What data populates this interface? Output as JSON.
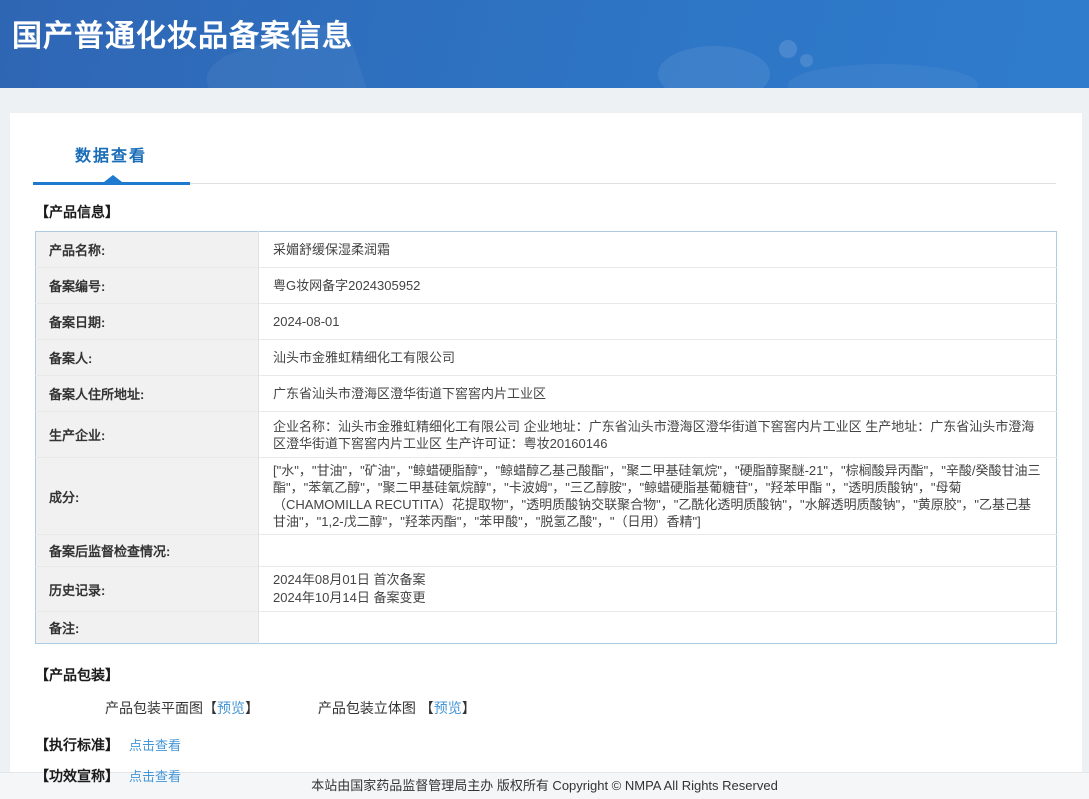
{
  "theme": {
    "header_blue_start": "#2f66b4",
    "header_blue_end": "#2f7ccd",
    "accent_blue": "#1e7ace",
    "tab_text_blue": "#1a6db8",
    "link_blue": "#4596d6",
    "label_cell_bg": "#f1f1f1",
    "table_border_blue": "#aecbe4"
  },
  "header": {
    "title": "国产普通化妆品备案信息"
  },
  "tabs": {
    "data_view": "数据查看"
  },
  "product_info": {
    "section_title": "【产品信息】",
    "rows": [
      {
        "label": "产品名称:",
        "value": "采媚舒缓保湿柔润霜"
      },
      {
        "label": "备案编号:",
        "value": "粤G妆网备字2024305952"
      },
      {
        "label": "备案日期:",
        "value": "2024-08-01"
      },
      {
        "label": "备案人:",
        "value": "汕头市金雅虹精细化工有限公司"
      },
      {
        "label": "备案人住所地址:",
        "value": "广东省汕头市澄海区澄华街道下窖窖内片工业区"
      },
      {
        "label": "生产企业:",
        "value": "企业名称：汕头市金雅虹精细化工有限公司 企业地址：广东省汕头市澄海区澄华街道下窖窖内片工业区 生产地址：广东省汕头市澄海区澄华街道下窖窖内片工业区 生产许可证：粤妆20160146"
      },
      {
        "label": "成分:",
        "value": "[\"水\"，\"甘油\"，\"矿油\"，\"鲸蜡硬脂醇\"，\"鲸蜡醇乙基己酸酯\"，\"聚二甲基硅氧烷\"，\"硬脂醇聚醚-21\"，\"棕榈酸异丙酯\"，\"辛酸/癸酸甘油三酯\"，\"苯氧乙醇\"，\"聚二甲基硅氧烷醇\"，\"卡波姆\"，\"三乙醇胺\"，\"鲸蜡硬脂基葡糖苷\"，\"羟苯甲酯 \"，\"透明质酸钠\"，\"母菊（CHAMOMILLA RECUTITA）花提取物\"，\"透明质酸钠交联聚合物\"，\"乙酰化透明质酸钠\"，\"水解透明质酸钠\"，\"黄原胶\"，\"乙基己基甘油\"，\"1,2-戊二醇\"，\"羟苯丙酯\"，\"苯甲酸\"，\"脱氢乙酸\"，\"（日用）香精\"]"
      },
      {
        "label": "备案后监督检查情况:",
        "value": ""
      },
      {
        "label": "历史记录:",
        "value_lines": [
          "2024年08月01日 首次备案",
          "2024年10月14日 备案变更"
        ]
      },
      {
        "label": "备注:",
        "value": ""
      }
    ]
  },
  "packaging": {
    "section_title": "【产品包装】",
    "flat": {
      "prefix": "产品包装平面图【",
      "link": "预览",
      "suffix": "】"
    },
    "stereo": {
      "prefix": "产品包装立体图 【",
      "link": "预览",
      "suffix": "】"
    }
  },
  "standard": {
    "title": "【执行标准】",
    "link": "点击查看"
  },
  "efficacy": {
    "title": "【功效宣称】",
    "link": "点击查看"
  },
  "footer": {
    "copyright": "本站由国家药品监督管理局主办 版权所有 Copyright © NMPA All Rights Reserved"
  }
}
